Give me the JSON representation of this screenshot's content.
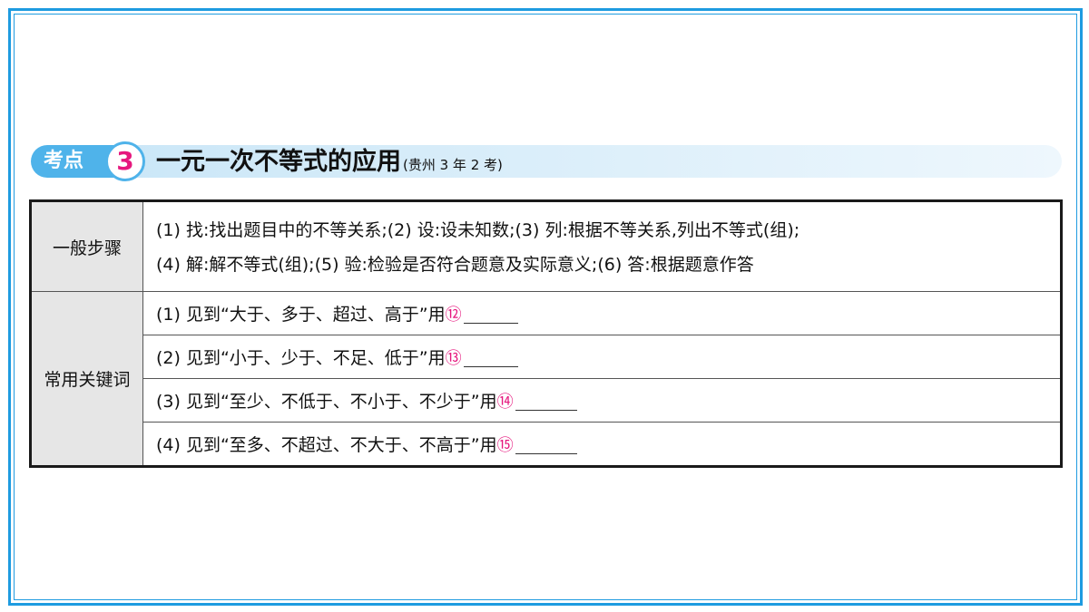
{
  "header": {
    "badge_label": "考点",
    "number": "3",
    "title": "一元一次不等式的应用",
    "note": "(贵州 3 年 2 考)"
  },
  "table": {
    "steps": {
      "label": "一般步骤",
      "line1": "(1) 找:找出题目中的不等关系;(2) 设:设未知数;(3) 列:根据不等关系,列出不等式(组);",
      "line2": "(4) 解:解不等式(组);(5) 验:检验是否符合题意及实际意义;(6) 答:根据题意作答"
    },
    "keywords": {
      "label": "常用关键词",
      "rows": [
        {
          "text": "(1) 见到“大于、多于、超过、高于”用",
          "marker": "⑫"
        },
        {
          "text": "(2) 见到“小于、少于、不足、低于”用",
          "marker": "⑬"
        },
        {
          "text": "(3) 见到“至少、不低于、不小于、不少于”用",
          "marker": "⑭"
        },
        {
          "text": "(4) 见到“至多、不超过、不大于、不高于”用",
          "marker": "⑮"
        }
      ]
    }
  },
  "colors": {
    "frame": "#1e9be0",
    "badge": "#4fb3ea",
    "accent": "#e6187e",
    "label_bg": "#e6e6e6"
  }
}
